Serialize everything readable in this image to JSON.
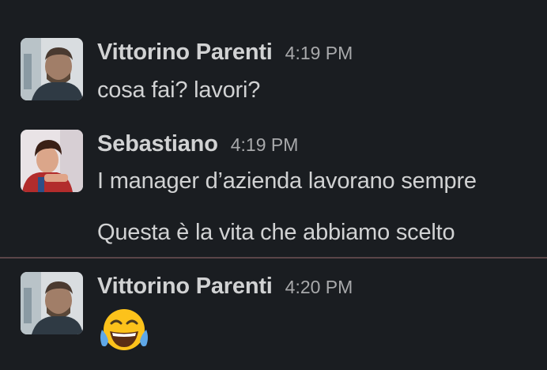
{
  "messages": [
    {
      "sender": "Vittorino Parenti",
      "time": "4:19 PM",
      "lines": [
        "cosa fai? lavori?"
      ],
      "avatar": "vittorino-avatar"
    },
    {
      "sender": "Sebastiano",
      "time": "4:19 PM",
      "lines": [
        "I manager d’azienda lavorano sempre",
        "Questa è la vita che abbiamo scelto"
      ],
      "avatar": "sebastiano-avatar"
    },
    {
      "sender": "Vittorino Parenti",
      "time": "4:20 PM",
      "lines": [],
      "emoji": "tears-of-joy-emoji",
      "avatar": "vittorino-avatar"
    }
  ],
  "colors": {
    "background": "#1a1d21",
    "text": "#d1d2d3",
    "timestamp": "#a8a9ab",
    "divider": "#5a4548"
  }
}
